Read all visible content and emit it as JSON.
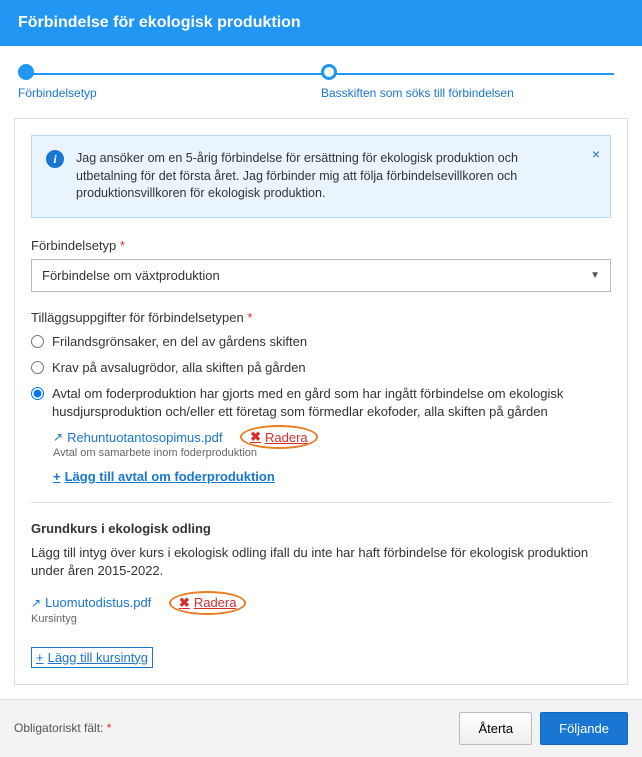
{
  "header": {
    "title": "Förbindelse för ekologisk produktion"
  },
  "stepper": {
    "step1": "Förbindelsetyp",
    "step2": "Basskiften som söks till förbindelsen"
  },
  "info": {
    "text": "Jag ansöker om en 5-årig förbindelse för ersättning för ekologisk produktion och utbetalning för det första året. Jag förbinder mig att följa förbindelsevillkoren och produktionsvillkoren för ekologisk produktion."
  },
  "form": {
    "type_label": "Förbindelsetyp",
    "type_value": "Förbindelse om växtproduktion",
    "extra_label": "Tilläggsuppgifter för förbindelsetypen",
    "radios": [
      "Frilandsgrönsaker, en del av gårdens skiften",
      "Krav på avsalugrödor, alla skiften på gården",
      "Avtal om foderproduktion har gjorts med en gård som har ingått förbindelse om ekologisk husdjursproduktion och/eller ett företag som förmedlar ekofoder, alla skiften på gården"
    ],
    "file1": {
      "name": "Rehuntuotantosopimus.pdf",
      "sub": "Avtal om samarbete inom foderproduktion"
    },
    "delete_label": "Radera",
    "add_feed": "Lägg till avtal om foderproduktion"
  },
  "course": {
    "heading": "Grundkurs i ekologisk odling",
    "text": "Lägg till intyg över kurs i ekologisk odling ifall du inte har haft förbindelse för ekologisk produktion under åren 2015-2022.",
    "file": {
      "name": "Luomutodistus.pdf",
      "sub": "Kursintyg"
    },
    "add": "Lägg till kursintyg"
  },
  "footer": {
    "required": "Obligatoriskt fält:",
    "back": "Återta",
    "next": "Följande"
  }
}
